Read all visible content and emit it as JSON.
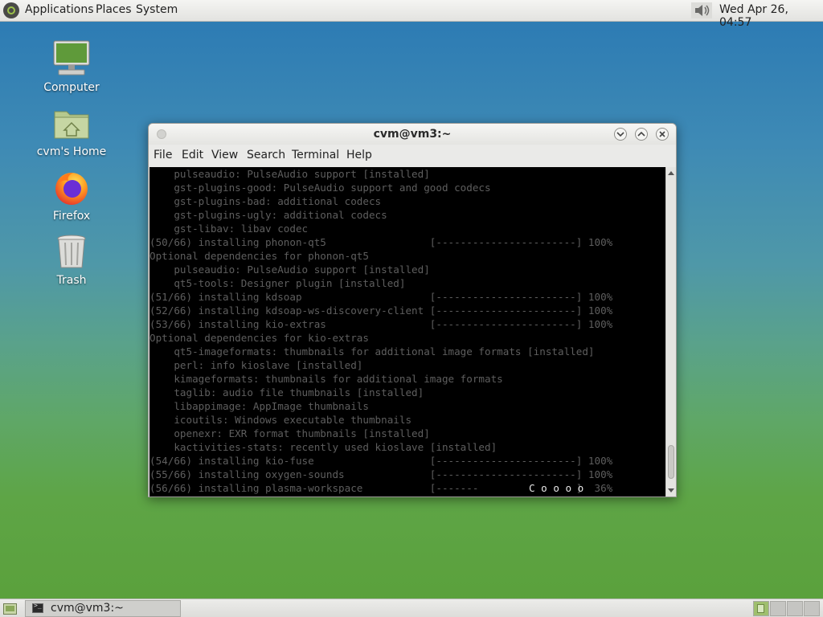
{
  "top_panel": {
    "menus": [
      "Applications",
      "Places",
      "System"
    ],
    "clock": "Wed Apr 26, 04:57",
    "icons": [
      "mate-menu-icon",
      "volume-icon"
    ]
  },
  "desktop_icons": [
    {
      "label": "Computer",
      "icon": "computer-icon"
    },
    {
      "label": "cvm's Home",
      "icon": "home-folder-icon"
    },
    {
      "label": "Firefox",
      "icon": "firefox-icon"
    },
    {
      "label": "Trash",
      "icon": "trash-icon"
    }
  ],
  "window": {
    "title": "cvm@vm3:~",
    "menu": [
      "File",
      "Edit",
      "View",
      "Search",
      "Terminal",
      "Help"
    ],
    "controls": [
      "minimize",
      "maximize",
      "close"
    ]
  },
  "terminal": {
    "lines": [
      "    pulseaudio: PulseAudio support [installed]",
      "    gst-plugins-good: PulseAudio support and good codecs",
      "    gst-plugins-bad: additional codecs",
      "    gst-plugins-ugly: additional codecs",
      "    gst-libav: libav codec",
      "(50/66) installing phonon-qt5                 [-----------------------] 100%",
      "Optional dependencies for phonon-qt5",
      "    pulseaudio: PulseAudio support [installed]",
      "    qt5-tools: Designer plugin [installed]",
      "(51/66) installing kdsoap                     [-----------------------] 100%",
      "(52/66) installing kdsoap-ws-discovery-client [-----------------------] 100%",
      "(53/66) installing kio-extras                 [-----------------------] 100%",
      "Optional dependencies for kio-extras",
      "    qt5-imageformats: thumbnails for additional image formats [installed]",
      "    perl: info kioslave [installed]",
      "    kimageformats: thumbnails for additional image formats",
      "    taglib: audio file thumbnails [installed]",
      "    libappimage: AppImage thumbnails",
      "    icoutils: Windows executable thumbnails",
      "    openexr: EXR format thumbnails [installed]",
      "    kactivities-stats: recently used kioslave [installed]",
      "(54/66) installing kio-fuse                   [-----------------------] 100%",
      "(55/66) installing oxygen-sounds              [-----------------------] 100%",
      "(56/66) installing plasma-workspace           [-------                ]  36%"
    ],
    "pacman_animation": "C o o o o"
  },
  "taskbar": {
    "task_label": "cvm@vm3:~",
    "workspaces": 4,
    "active_workspace": 1
  }
}
